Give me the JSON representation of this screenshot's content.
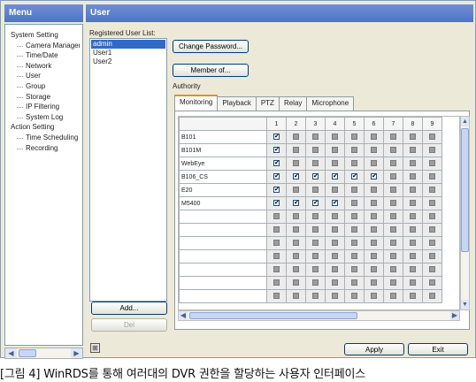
{
  "menu": {
    "title": "Menu",
    "items": [
      {
        "label": "System Setting",
        "level": 0
      },
      {
        "label": "Camera Manageme",
        "level": 1
      },
      {
        "label": "Time/Date",
        "level": 1
      },
      {
        "label": "Network",
        "level": 1
      },
      {
        "label": "User",
        "level": 1
      },
      {
        "label": "Group",
        "level": 1
      },
      {
        "label": "Storage",
        "level": 1
      },
      {
        "label": "IP Filtering",
        "level": 1
      },
      {
        "label": "System Log",
        "level": 1
      },
      {
        "label": "Action Setting",
        "level": 0
      },
      {
        "label": "Time Scheduling",
        "level": 1
      },
      {
        "label": "Recording",
        "level": 1
      }
    ]
  },
  "user_panel": {
    "title": "User",
    "registered_label": "Registered User List:",
    "users": [
      "admin",
      "User1",
      "User2"
    ],
    "selected_user": "admin",
    "change_password": "Change Password...",
    "member_of": "Member of...",
    "authority_label": "Authority",
    "add_button": "Add...",
    "del_button": "Del",
    "apply_button": "Apply",
    "exit_button": "Exit"
  },
  "tabs": [
    "Monitoring",
    "Playback",
    "PTZ",
    "Relay",
    "Microphone"
  ],
  "active_tab": "Monitoring",
  "grid": {
    "columns": [
      "1",
      "2",
      "3",
      "4",
      "5",
      "6",
      "7",
      "8",
      "9"
    ],
    "rows": [
      {
        "name": "B101",
        "checks": [
          1,
          0,
          0,
          0,
          0,
          0,
          0,
          0,
          0
        ]
      },
      {
        "name": "B101M",
        "checks": [
          1,
          0,
          0,
          0,
          0,
          0,
          0,
          0,
          0
        ]
      },
      {
        "name": "WebEye",
        "checks": [
          1,
          0,
          0,
          0,
          0,
          0,
          0,
          0,
          0
        ]
      },
      {
        "name": "B106_CS",
        "checks": [
          1,
          1,
          1,
          1,
          1,
          1,
          0,
          0,
          0
        ]
      },
      {
        "name": "E20",
        "checks": [
          1,
          0,
          0,
          0,
          0,
          0,
          0,
          0,
          0
        ]
      },
      {
        "name": "M5400",
        "checks": [
          1,
          1,
          1,
          1,
          0,
          0,
          0,
          0,
          0
        ]
      },
      {
        "name": "",
        "checks": [
          0,
          0,
          0,
          0,
          0,
          0,
          0,
          0,
          0
        ]
      },
      {
        "name": "",
        "checks": [
          0,
          0,
          0,
          0,
          0,
          0,
          0,
          0,
          0
        ]
      },
      {
        "name": "",
        "checks": [
          0,
          0,
          0,
          0,
          0,
          0,
          0,
          0,
          0
        ]
      },
      {
        "name": "",
        "checks": [
          0,
          0,
          0,
          0,
          0,
          0,
          0,
          0,
          0
        ]
      },
      {
        "name": "",
        "checks": [
          0,
          0,
          0,
          0,
          0,
          0,
          0,
          0,
          0
        ]
      },
      {
        "name": "",
        "checks": [
          0,
          0,
          0,
          0,
          0,
          0,
          0,
          0,
          0
        ]
      },
      {
        "name": "",
        "checks": [
          0,
          0,
          0,
          0,
          0,
          0,
          0,
          0,
          0
        ]
      }
    ]
  },
  "caption": "[그림 4] WinRDS를 통해 여러대의 DVR 권한을 할당하는 사용자 인터페이스"
}
